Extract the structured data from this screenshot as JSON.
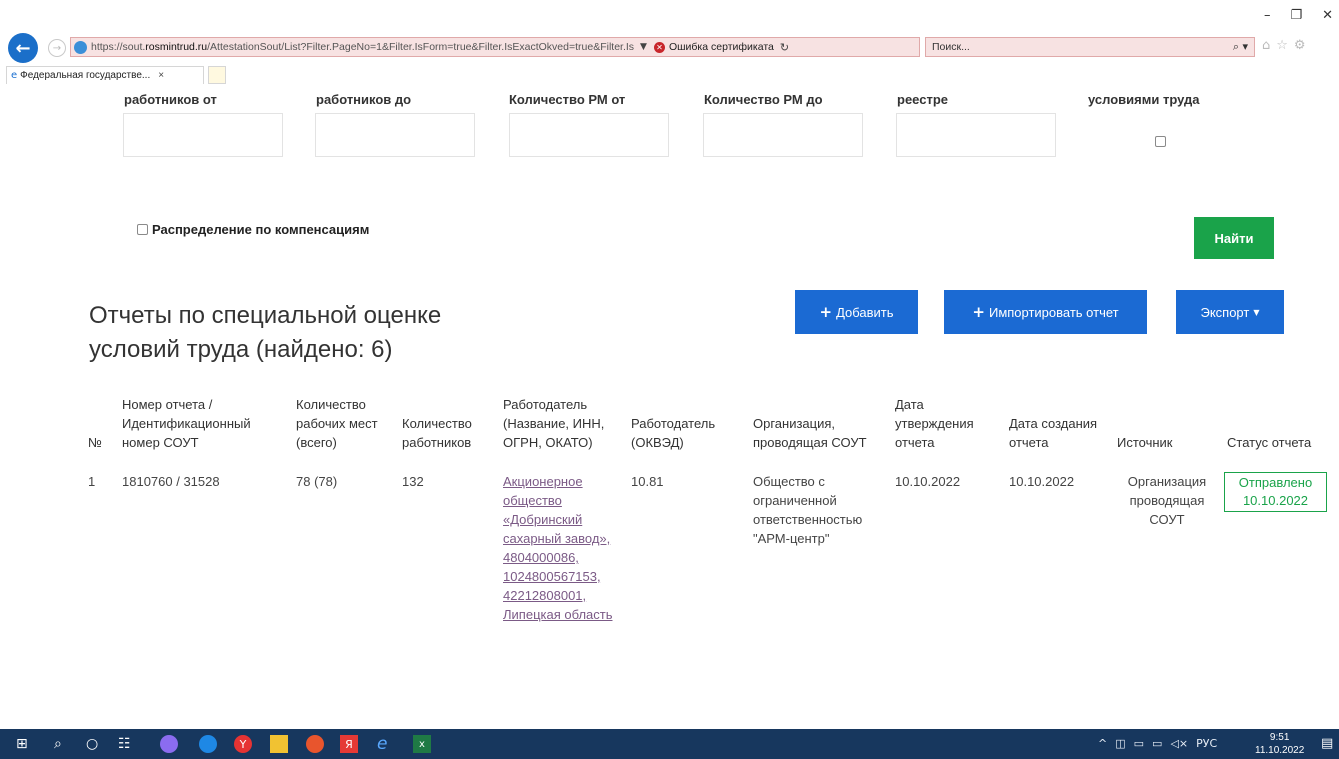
{
  "browser": {
    "window_controls": [
      "–",
      "❐",
      "✕"
    ],
    "url_prefix": "https://sout.",
    "url_domain": "rosmintrud.ru",
    "url_path": "/AttestationSout/List?Filter.PageNo=1&Filter.IsForm=true&Filter.IsExactOkved=true&Filter.Is",
    "cert_error": "Ошибка сертификата",
    "search_placeholder": "Поиск...",
    "tab_title": "Федеральная государстве...",
    "tab_close": "×"
  },
  "filters": {
    "workers_from": "работников от",
    "workers_to": "работников до",
    "rm_from": "Количество РМ от",
    "rm_to": "Количество РМ до",
    "registry": "реестре",
    "harmful": "условиями труда",
    "compensation_label": "Распределение по компенсациям",
    "find_button": "Найти"
  },
  "reports": {
    "title": "Отчеты по специальной оценке условий труда (найдено: 6)",
    "add_button": "Добавить",
    "import_button": "Импортировать отчет",
    "export_button": "Экспорт",
    "columns": [
      "№",
      "Номер отчета / Идентификационный номер СОУТ",
      "Количество рабочих мест (всего)",
      "Количество работников",
      "Работодатель (Название, ИНН, ОГРН, ОКАТО)",
      "Работодатель (ОКВЭД)",
      "Организация, проводящая СОУТ",
      "Дата утверждения отчета",
      "Дата создания отчета",
      "Источник",
      "Статус отчета"
    ],
    "rows": [
      {
        "no": "1",
        "number": "1810760 / 31528",
        "places": "78 (78)",
        "workers": "132",
        "employer": "Акционерное общество «Добринский сахарный завод», 4804000086, 1024800567153, 42212808001, Липецкая область",
        "okved": "10.81",
        "organization": "Общество с ограниченной ответственностью \"АРМ-центр\"",
        "approved": "10.10.2022",
        "created": "10.10.2022",
        "source": "Организация проводящая СОУТ",
        "status": "Отправлено 10.10.2022"
      }
    ]
  },
  "taskbar": {
    "language": "РУС",
    "time": "9:51",
    "date": "11.10.2022"
  }
}
